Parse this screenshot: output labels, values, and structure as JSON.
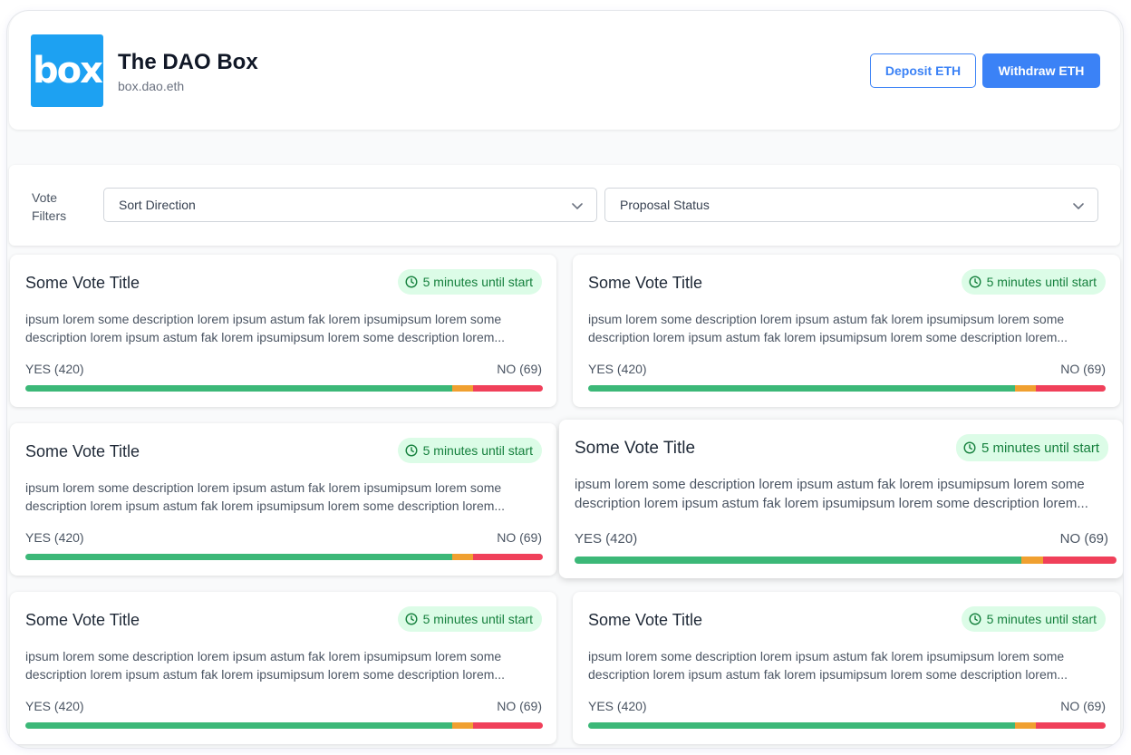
{
  "header": {
    "logo_text": "box",
    "title": "The DAO Box",
    "ens": "box.dao.eth",
    "deposit_label": "Deposit ETH",
    "withdraw_label": "Withdraw ETH",
    "accent_color": "#3b82f6"
  },
  "filters": {
    "label": "Vote Filters",
    "sort_direction": "Sort Direction",
    "proposal_status": "Proposal Status"
  },
  "votes": [
    {
      "title": "Some Vote Title",
      "status": "5 minutes until start",
      "description": "ipsum lorem some description lorem ipsum astum fak lorem ipsumipsum lorem some description lorem ipsum astum fak lorem ipsumipsum lorem some description lorem...",
      "yes_label": "YES (420)",
      "no_label": "NO (69)",
      "yes_share": 0.825,
      "abstain_share": 0.04,
      "no_share": 0.135
    },
    {
      "title": "Some Vote Title",
      "status": "5 minutes until start",
      "description": "ipsum lorem some description lorem ipsum astum fak lorem ipsumipsum lorem some description lorem ipsum astum fak lorem ipsumipsum lorem some description lorem...",
      "yes_label": "YES (420)",
      "no_label": "NO (69)",
      "yes_share": 0.825,
      "abstain_share": 0.04,
      "no_share": 0.135
    },
    {
      "title": "Some Vote Title",
      "status": "5 minutes until start",
      "description": "ipsum lorem some description lorem ipsum astum fak lorem ipsumipsum lorem some description lorem ipsum astum fak lorem ipsumipsum lorem some description lorem...",
      "yes_label": "YES (420)",
      "no_label": "NO (69)",
      "yes_share": 0.825,
      "abstain_share": 0.04,
      "no_share": 0.135
    },
    {
      "title": "Some Vote Title",
      "status": "5 minutes until start",
      "description": "ipsum lorem some description lorem ipsum astum fak lorem ipsumipsum lorem some description lorem ipsum astum fak lorem ipsumipsum lorem some description lorem...",
      "yes_label": "YES (420)",
      "no_label": "NO (69)",
      "yes_share": 0.825,
      "abstain_share": 0.04,
      "no_share": 0.135
    },
    {
      "title": "Some Vote Title",
      "status": "5 minutes until start",
      "description": "ipsum lorem some description lorem ipsum astum fak lorem ipsumipsum lorem some description lorem ipsum astum fak lorem ipsumipsum lorem some description lorem...",
      "yes_label": "YES (420)",
      "no_label": "NO (69)",
      "yes_share": 0.825,
      "abstain_share": 0.04,
      "no_share": 0.135
    },
    {
      "title": "Some Vote Title",
      "status": "5 minutes until start",
      "description": "ipsum lorem some description lorem ipsum astum fak lorem ipsumipsum lorem some description lorem ipsum astum fak lorem ipsumipsum lorem some description lorem...",
      "yes_label": "YES (420)",
      "no_label": "NO (69)",
      "yes_share": 0.825,
      "abstain_share": 0.04,
      "no_share": 0.135
    }
  ],
  "colors": {
    "yes": "#3cb878",
    "abstain": "#f0a030",
    "no": "#f0405a",
    "badge_bg": "#dcfce7",
    "badge_text": "#15803d"
  }
}
